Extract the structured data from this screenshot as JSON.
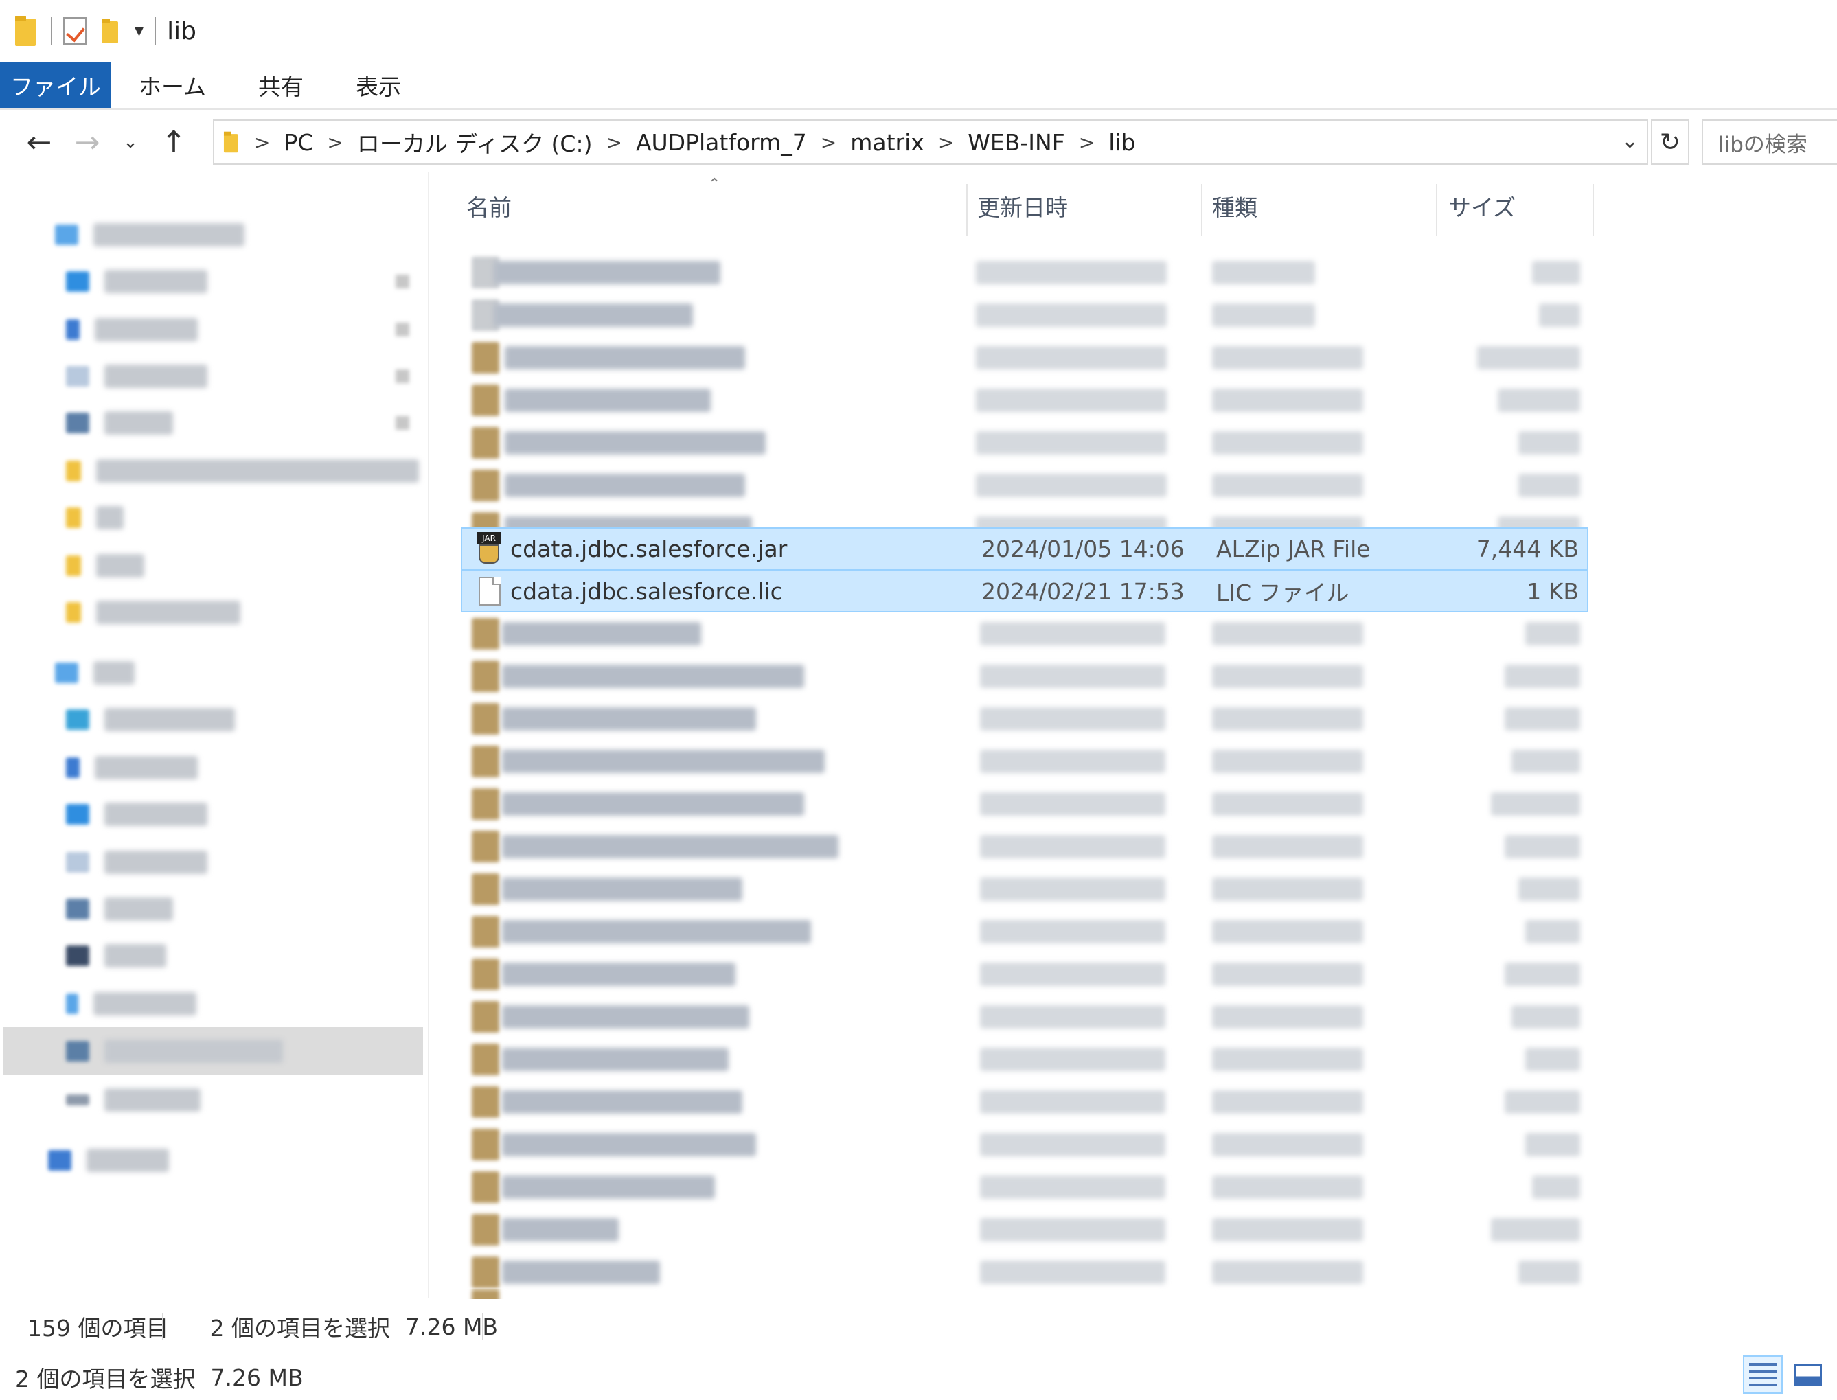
{
  "window": {
    "title": "lib"
  },
  "ribbon": {
    "tabs": [
      "ファイル",
      "ホーム",
      "共有",
      "表示"
    ]
  },
  "address": {
    "crumbs": [
      "PC",
      "ローカル ディスク (C:)",
      "AUDPlatform_7",
      "matrix",
      "WEB-INF",
      "lib"
    ],
    "separator": ">",
    "search_placeholder": "libの検索"
  },
  "columns": {
    "name": "名前",
    "date": "更新日時",
    "type": "種類",
    "size": "サイズ"
  },
  "files": {
    "jar": {
      "name": "cdata.jdbc.salesforce.jar",
      "date": "2024/01/05 14:06",
      "type": "ALZip JAR File",
      "size": "7,444 KB",
      "icon_label": "JAR"
    },
    "lic": {
      "name": "cdata.jdbc.salesforce.lic",
      "date": "2024/02/21 17:53",
      "type": "LIC ファイル",
      "size": "1 KB"
    }
  },
  "status": {
    "item_count": "159 個の項目",
    "selected": "2 個の項目を選択",
    "selected_size": "7.26 MB"
  },
  "colors": {
    "accent": "#1a63b4",
    "selection": "#cce8ff",
    "selection_border": "#99d1ff"
  }
}
